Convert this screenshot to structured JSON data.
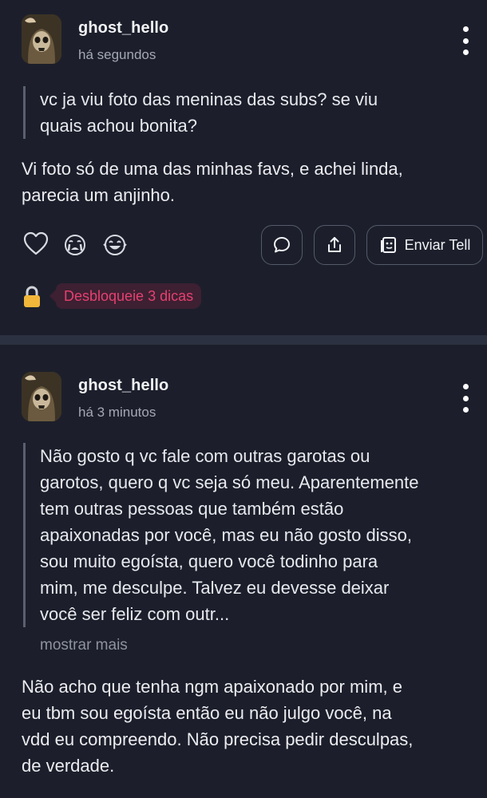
{
  "posts": [
    {
      "username": "ghost_hello",
      "time": "há segundos",
      "question": "vc ja viu foto das meninas das subs? se viu\nquais achou bonita?",
      "answer": "Vi foto só de uma das minhas favs, e achei linda,\nparecia um anjinho.",
      "actions": {
        "send_label": "Enviar Tell"
      },
      "unlock": {
        "label": "Desbloqueie 3 dicas"
      }
    },
    {
      "username": "ghost_hello",
      "time": "há 3 minutos",
      "question": "Não gosto q vc fale com outras garotas ou\ngarotos, quero q vc seja só meu. Aparentemente\ntem outras pessoas que também estão\napaixonadas por você, mas eu não gosto disso,\nsou muito egoísta, quero você todinho para\nmim, me desculpe. Talvez eu devesse deixar\nvocê ser feliz com outr...",
      "show_more": "mostrar mais",
      "answer": "Não acho que tenha ngm apaixonado por mim, e\neu tbm sou egoísta então eu não julgo você, na\nvdd eu compreendo. Não precisa pedir desculpas,\nde verdade."
    }
  ],
  "colors": {
    "background": "#1c1f2b",
    "divider": "#2b3140",
    "tips_text": "#e6406f",
    "tips_bg": "#3d2032",
    "lock": "#f2b63a"
  },
  "icons": [
    "more-vertical-icon",
    "heart-icon",
    "crying-emoji-icon",
    "laughing-emoji-icon",
    "comment-icon",
    "share-icon",
    "send-tell-icon",
    "lock-icon"
  ]
}
